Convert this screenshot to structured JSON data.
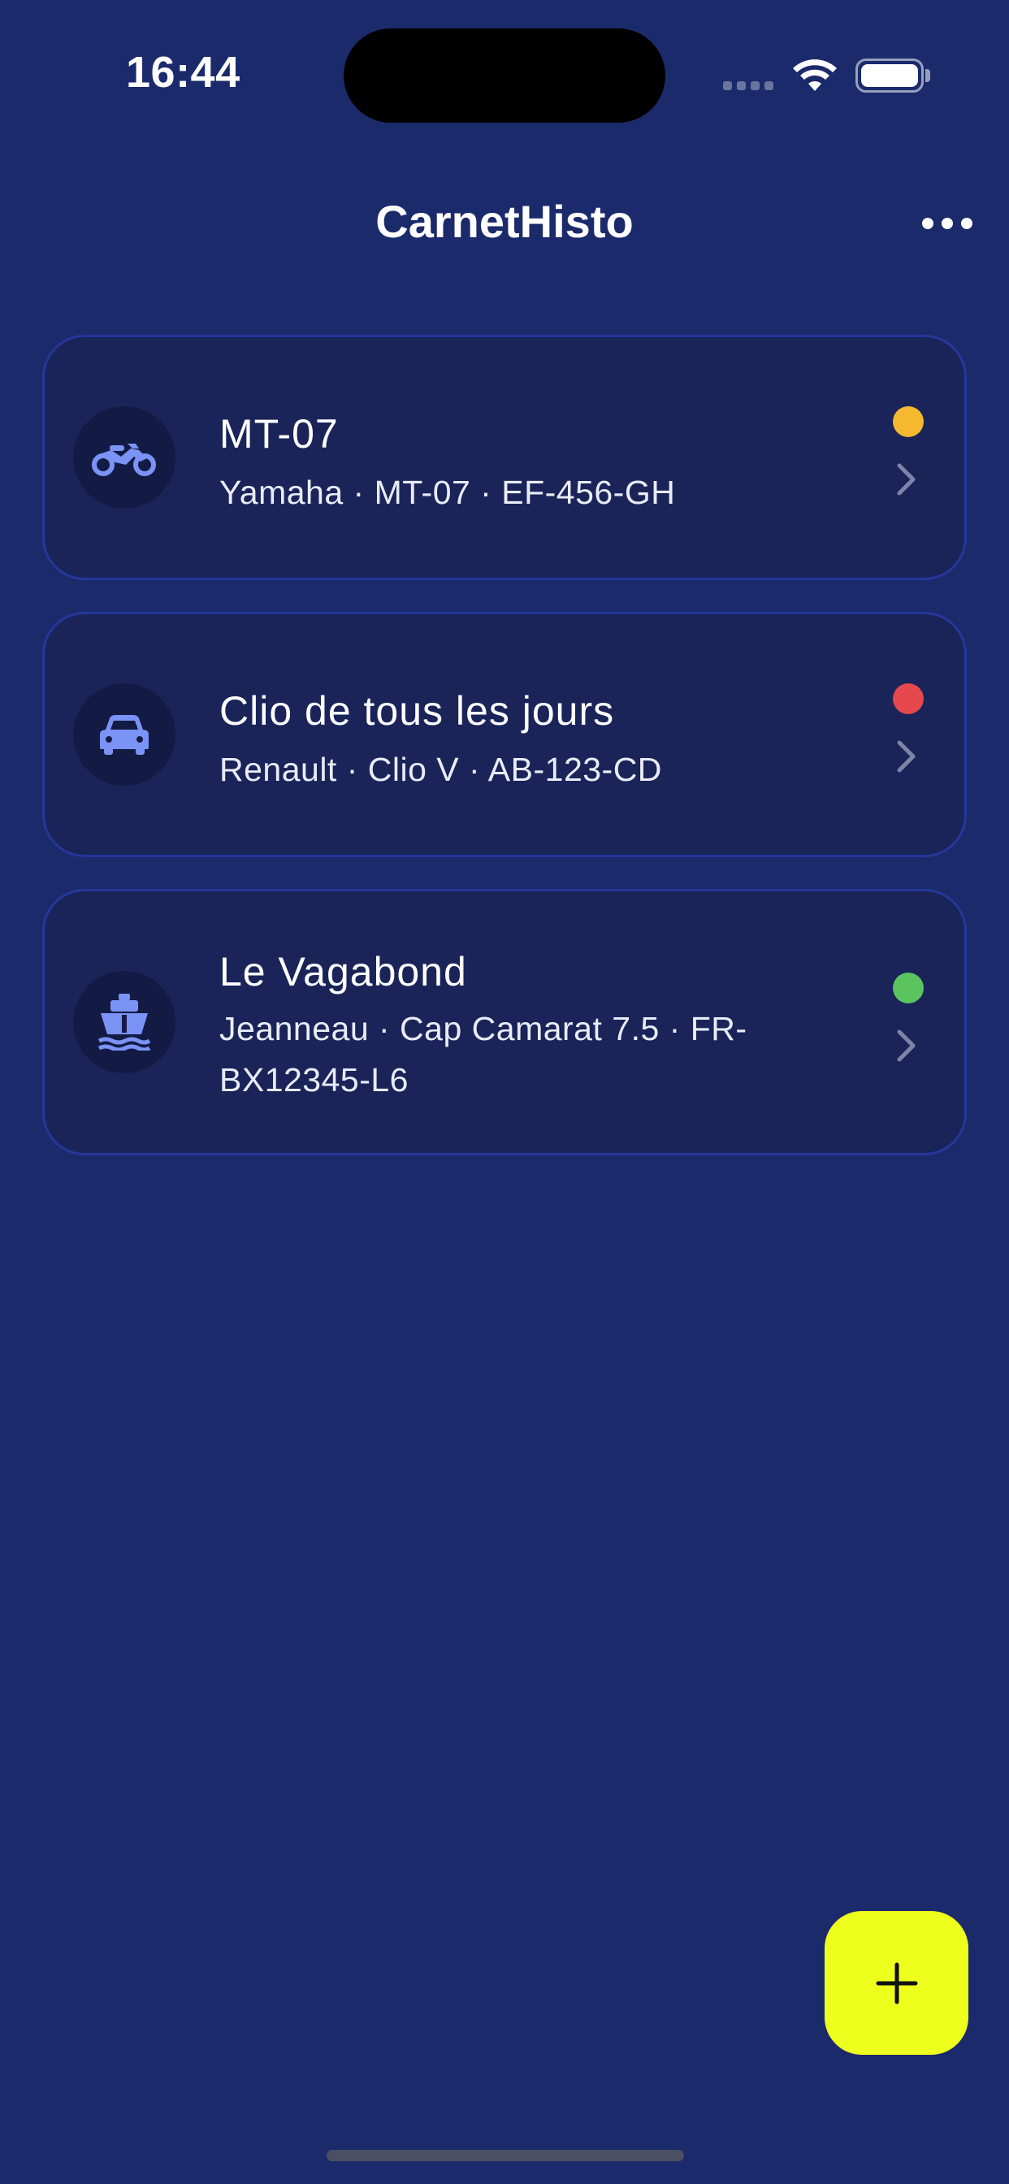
{
  "status_bar": {
    "time": "16:44"
  },
  "nav": {
    "title": "CarnetHisto",
    "more_icon": "ellipsis-icon"
  },
  "vehicles": [
    {
      "name": "MT-07",
      "details": "Yamaha · MT-07 · EF-456-GH",
      "icon": "motorcycle-icon",
      "status_color": "#f5b82e"
    },
    {
      "name": "Clio de tous les jours",
      "details": "Renault · Clio V · AB-123-CD",
      "icon": "car-icon",
      "status_color": "#e5484d"
    },
    {
      "name": "Le Vagabond",
      "details": "Jeanneau · Cap Camarat 7.5 · FR-BX12345-L6",
      "icon": "boat-icon",
      "status_color": "#5cc45e"
    }
  ],
  "fab": {
    "icon": "plus-icon"
  },
  "colors": {
    "background": "#1b2a6b",
    "card": "#1a2459",
    "card_border": "#25379a",
    "icon_accent": "#7b93f5",
    "fab": "#eeff1e"
  }
}
